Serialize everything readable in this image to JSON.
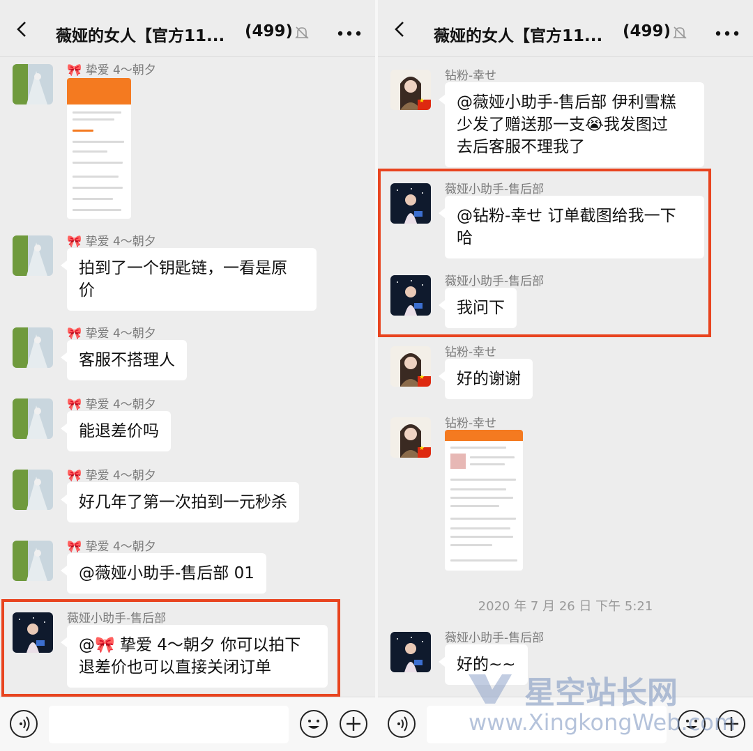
{
  "header": {
    "title": "薇娅的女人【官方11...",
    "member_count": "(499)"
  },
  "left_panel": {
    "messages": [
      {
        "sender": "🎀 挚爱 4～朝夕",
        "type": "image"
      },
      {
        "sender": "🎀 挚爱 4～朝夕",
        "text_line1": "拍到了一个钥匙链，一看是原",
        "text_line2": "价"
      },
      {
        "sender": "🎀 挚爱 4～朝夕",
        "text": "客服不搭理人"
      },
      {
        "sender": "🎀 挚爱 4～朝夕",
        "text": "能退差价吗"
      },
      {
        "sender": "🎀 挚爱 4～朝夕",
        "text": "好几年了第一次拍到一元秒杀"
      },
      {
        "sender": "🎀 挚爱 4～朝夕",
        "text": "@薇娅小助手-售后部 01"
      },
      {
        "sender": "薇娅小助手-售后部",
        "text_line1": "@🎀 挚爱 4～朝夕 你可以拍下",
        "text_line2": "退差价也可以直接关闭订单"
      }
    ]
  },
  "right_panel": {
    "messages": [
      {
        "sender": "钻粉-幸せ",
        "text_line1": "@薇娅小助手-售后部 伊利雪糕",
        "text_line2": "少发了赠送那一支😭我发图过",
        "text_line3": "去后客服不理我了"
      },
      {
        "sender": "薇娅小助手-售后部",
        "text_line1": "@钻粉-幸せ 订单截图给我一下",
        "text_line2": "哈"
      },
      {
        "sender": "薇娅小助手-售后部",
        "text": "我问下"
      },
      {
        "sender": "钻粉-幸せ",
        "text": "好的谢谢"
      },
      {
        "sender": "钻粉-幸せ",
        "type": "image"
      },
      {
        "sender": "薇娅小助手-售后部",
        "text": "好的~~"
      }
    ],
    "timestamp": "2020 年 7 月 26 日 下午 5:21"
  },
  "watermark": {
    "brand": "星空站长网",
    "url": "www.XingkongWeb.com"
  },
  "colors": {
    "background": "#ededed",
    "bubble": "#ffffff",
    "highlight": "#e8441f",
    "order_orange": "#f47a20"
  },
  "icons": [
    "back-arrow-icon",
    "mute-bell-icon",
    "more-dots-icon",
    "voice-icon",
    "emoji-icon",
    "plus-icon"
  ]
}
